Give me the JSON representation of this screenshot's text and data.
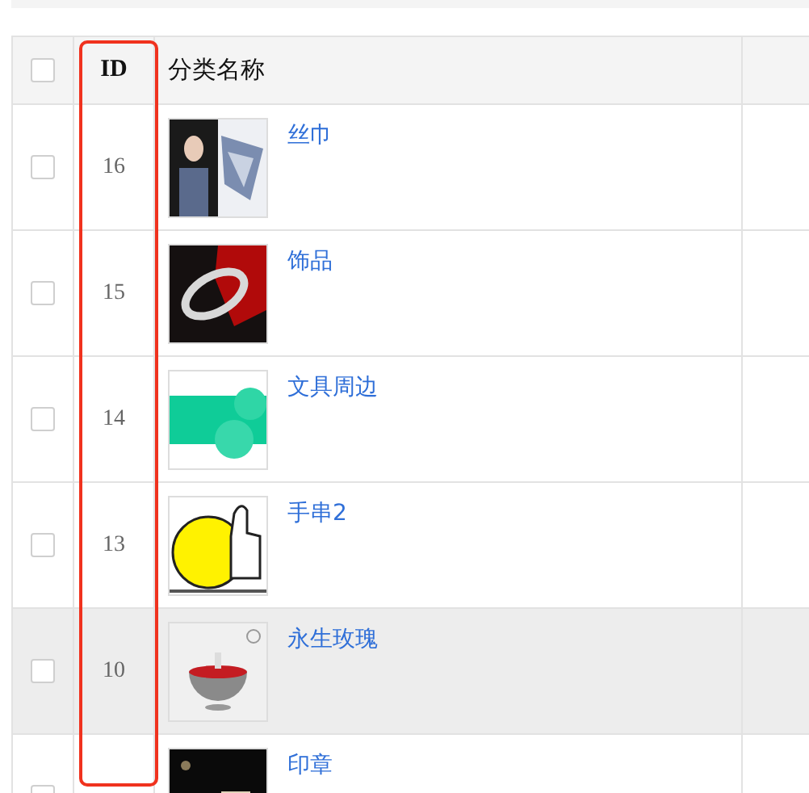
{
  "table": {
    "columns": [
      {
        "label": "ID"
      },
      {
        "label": "分类名称"
      }
    ],
    "header_checkbox": {
      "checked": false
    },
    "rows": [
      {
        "id": "16",
        "name": "丝巾",
        "checked": false,
        "highlighted": false
      },
      {
        "id": "15",
        "name": "饰品",
        "checked": false,
        "highlighted": false
      },
      {
        "id": "14",
        "name": "文具周边",
        "checked": false,
        "highlighted": false
      },
      {
        "id": "13",
        "name": "手串2",
        "checked": false,
        "highlighted": false
      },
      {
        "id": "10",
        "name": "永生玫瑰",
        "checked": false,
        "highlighted": true
      },
      {
        "name": "印章",
        "checked": false,
        "highlighted": false
      }
    ]
  },
  "annotation": {
    "kind": "highlight"
  }
}
